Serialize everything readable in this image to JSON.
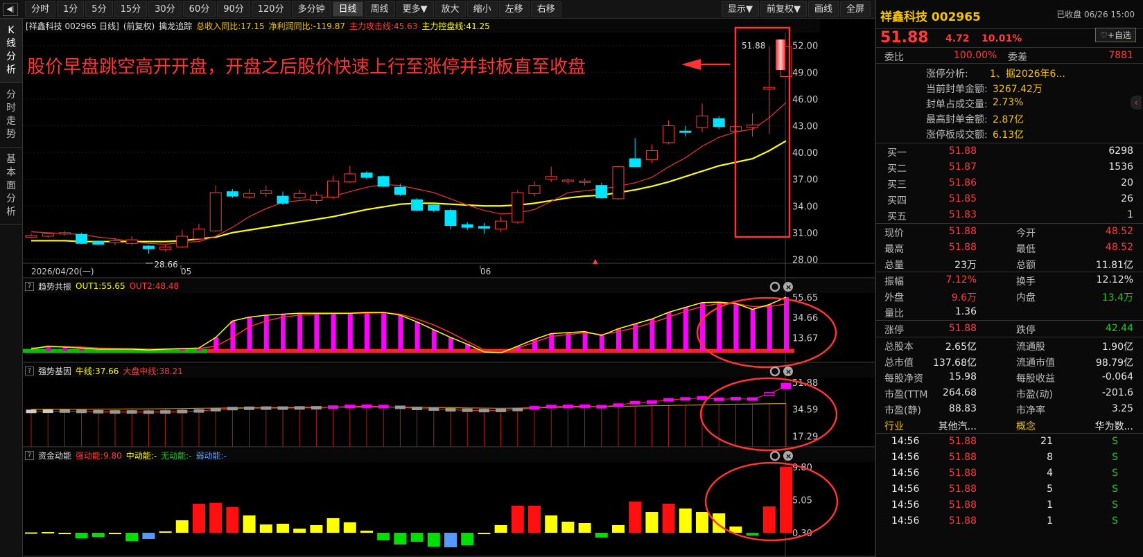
{
  "toolbar": {
    "collapse": "◀|",
    "items": [
      "分时",
      "1分",
      "5分",
      "15分",
      "30分",
      "60分",
      "90分",
      "120分",
      "多分钟",
      "日线",
      "周线",
      "更多▼",
      "放大",
      "缩小",
      "左移",
      "右移"
    ],
    "active": "日线",
    "right": [
      "显示▼",
      "前复权▼",
      "画线",
      "全屏"
    ]
  },
  "side_tabs": [
    "K线分析",
    "分时走势",
    "基本面分析"
  ],
  "main_header": {
    "stock": "[祥鑫科技 002965 日线]",
    "adj": "(前复权)",
    "ind": "擒龙追踪",
    "revenue_yoy": "总收入同比:17.15",
    "profit_yoy": "净利润同比:-119.87",
    "attack": "主力攻击线:45.63",
    "control": "主力控盘线:41.25"
  },
  "annotation": "股价早盘跳空高开开盘，开盘之后股价快速上行至涨停并封板直至收盘",
  "date_axis": {
    "start": "2026/04/20(一)",
    "m1": "05",
    "m2": "06"
  },
  "price_axis": [
    "52.00",
    "49.00",
    "46.00",
    "43.00",
    "40.00",
    "37.00",
    "34.00",
    "31.00",
    "28.00"
  ],
  "low_label": "28.66",
  "high_label": "51.88",
  "panel1": {
    "name": "趋势共振",
    "out1": "OUT1:55.65",
    "out2": "OUT2:48.48",
    "axis": [
      "55.65",
      "34.66",
      "13.67"
    ]
  },
  "panel2": {
    "name": "强势基因",
    "bull": "牛线:37.66",
    "market": "大盘中线:38.21",
    "axis": [
      "51.88",
      "34.59",
      "17.29"
    ]
  },
  "panel3": {
    "name": "资金动能",
    "strong": "强动能:9.80",
    "mid": "中动能:-",
    "none": "无动能:-",
    "weak": "弱动能:-",
    "axis": [
      "9.80",
      "5.05",
      "0.30"
    ]
  },
  "chart_data": [
    {
      "type": "candlestick",
      "title": "祥鑫科技 002965 日线",
      "open": [
        30.5,
        30.6,
        30.9,
        30.8,
        30.0,
        29.9,
        29.8,
        29.5,
        29.1,
        29.4,
        30.3,
        31.2,
        35.6,
        35.0,
        35.4,
        35.1,
        34.9,
        34.6,
        35.0,
        36.7,
        37.7,
        37.3,
        36.1,
        34.7,
        34.1,
        33.5,
        31.9,
        31.7,
        31.4,
        32.2,
        35.4,
        37.0,
        36.8,
        36.8,
        36.3,
        34.8,
        39.3,
        39.2,
        41.1,
        42.4,
        42.8,
        43.8,
        42.4,
        42.8,
        47.1,
        48.52
      ],
      "close": [
        30.7,
        30.9,
        31.0,
        29.8,
        29.7,
        30.1,
        30.2,
        29.2,
        29.4,
        30.6,
        31.4,
        35.5,
        35.1,
        35.4,
        35.7,
        34.3,
        35.4,
        35.2,
        36.8,
        37.6,
        37.2,
        36.2,
        35.3,
        33.5,
        33.5,
        31.8,
        31.6,
        31.5,
        32.3,
        35.5,
        36.3,
        37.3,
        36.9,
        36.8,
        34.9,
        38.4,
        38.4,
        40.2,
        43.0,
        42.3,
        44.1,
        42.9,
        42.9,
        43.1,
        47.3,
        51.88
      ],
      "high": [
        30.9,
        31.0,
        31.2,
        31.0,
        30.1,
        30.4,
        30.6,
        29.6,
        29.6,
        31.3,
        32.0,
        36.3,
        35.9,
        35.9,
        36.3,
        35.6,
        35.8,
        35.6,
        37.4,
        38.5,
        37.9,
        37.4,
        36.5,
        34.9,
        34.3,
        33.7,
        32.2,
        32.1,
        32.8,
        35.8,
        36.8,
        38.4,
        37.1,
        37.1,
        36.6,
        38.5,
        41.6,
        40.9,
        43.6,
        43.0,
        45.5,
        44.1,
        43.5,
        44.4,
        51.88,
        51.88
      ],
      "low": [
        30.4,
        30.4,
        30.7,
        29.7,
        29.6,
        29.6,
        29.6,
        28.66,
        28.9,
        29.3,
        30.1,
        31.1,
        34.9,
        34.8,
        35.0,
        34.1,
        34.8,
        34.3,
        34.8,
        36.6,
        37.0,
        36.1,
        35.1,
        33.4,
        33.3,
        31.4,
        31.3,
        30.9,
        31.1,
        32.0,
        35.1,
        36.7,
        36.4,
        36.3,
        34.8,
        34.7,
        39.0,
        38.8,
        40.9,
        41.8,
        42.3,
        42.6,
        41.7,
        41.8,
        42.1,
        48.52
      ],
      "ma_fast": [
        31.1,
        31.0,
        30.9,
        30.8,
        30.5,
        30.3,
        30.0,
        29.8,
        29.7,
        29.9,
        30.0,
        30.6,
        31.6,
        32.8,
        33.7,
        34.4,
        34.6,
        34.8,
        35.1,
        35.6,
        36.1,
        36.4,
        36.3,
        35.9,
        35.5,
        34.8,
        34.1,
        33.5,
        33.1,
        33.2,
        33.6,
        34.5,
        35.5,
        35.7,
        35.9,
        36.2,
        36.6,
        37.2,
        38.4,
        39.4,
        40.7,
        41.7,
        42.3,
        42.6,
        43.9,
        45.6
      ],
      "ma_slow": [
        30.1,
        30.1,
        30.1,
        30.0,
        30.0,
        30.0,
        30.0,
        30.0,
        30.0,
        30.1,
        30.3,
        30.5,
        31.0,
        31.3,
        31.6,
        31.9,
        32.2,
        32.5,
        32.8,
        33.2,
        33.6,
        33.9,
        34.2,
        34.3,
        34.3,
        34.2,
        34.1,
        34.0,
        34.0,
        34.1,
        34.3,
        34.6,
        34.9,
        35.1,
        35.2,
        35.5,
        35.8,
        36.2,
        36.7,
        37.3,
        37.9,
        38.5,
        38.9,
        39.3,
        40.2,
        41.3
      ],
      "x_labels": [
        "2026/04/20(一)",
        "05",
        "06"
      ],
      "y_ticks": [
        "52.00",
        "49.00",
        "46.00",
        "43.00",
        "40.00",
        "37.00",
        "34.00",
        "31.00",
        "28.00"
      ]
    },
    {
      "type": "bar",
      "title": "趋势共振",
      "series": [
        {
          "name": "OUT1",
          "values": [
            2.0,
            5.0,
            4.0,
            3.0,
            2.0,
            2.0,
            2.0,
            1.0,
            2.0,
            2.5,
            3.0,
            14.0,
            31.0,
            35.0,
            37.0,
            38.0,
            39.0,
            39.0,
            39.0,
            39.0,
            40.0,
            40.0,
            37.0,
            30.0,
            22.0,
            14.0,
            7.0,
            -1.0,
            -2.0,
            5.0,
            12.0,
            18.0,
            19.0,
            20.0,
            16.0,
            23.0,
            28.0,
            33.0,
            40.0,
            45.0,
            50.0,
            50.5,
            49.0,
            43.0,
            48.0,
            55.65
          ]
        },
        {
          "name": "OUT2",
          "values": [
            3.0,
            4.0,
            4.5,
            4.0,
            3.0,
            2.5,
            2.2,
            2.0,
            2.0,
            2.2,
            2.5,
            5.0,
            14.0,
            25.0,
            31.0,
            35.0,
            37.0,
            38.0,
            38.5,
            38.8,
            39.0,
            39.5,
            38.0,
            33.0,
            27.0,
            19.0,
            10.0,
            1.0,
            -2.0,
            3.0,
            9.0,
            15.0,
            17.0,
            19.0,
            17.0,
            20.0,
            24.0,
            29.0,
            35.0,
            41.0,
            46.0,
            49.0,
            49.0,
            46.0,
            46.0,
            48.48
          ]
        }
      ],
      "y_ticks": [
        "55.65",
        "34.66",
        "13.67"
      ]
    },
    {
      "type": "bar",
      "title": "强势基因",
      "series": [
        {
          "name": "牛线",
          "values": [
            33.2,
            33.3,
            33.4,
            33.2,
            33.0,
            32.8,
            32.8,
            32.7,
            32.8,
            33.1,
            33.5,
            34.3,
            35.0,
            35.2,
            35.3,
            35.3,
            35.4,
            35.5,
            35.9,
            36.4,
            36.5,
            36.3,
            35.8,
            35.1,
            34.7,
            34.2,
            33.9,
            33.7,
            33.8,
            34.4,
            35.5,
            36.3,
            36.4,
            36.5,
            36.2,
            37.2,
            38.8,
            39.2,
            40.6,
            41.2,
            41.8,
            41.0,
            41.3,
            41.1,
            44.4,
            49.5
          ]
        },
        {
          "name": "大盘中线",
          "values": [
            34.5,
            34.6,
            34.6,
            34.6,
            34.7,
            34.7,
            34.8,
            34.8,
            34.9,
            35.0,
            35.2,
            35.3,
            35.4,
            35.5,
            35.6,
            35.7,
            35.8,
            35.8,
            35.9,
            36.0,
            36.0,
            36.0,
            35.9,
            35.8,
            35.7,
            35.6,
            35.4,
            35.3,
            35.2,
            35.3,
            35.5,
            35.7,
            35.9,
            36.1,
            36.2,
            36.4,
            36.6,
            36.8,
            37.0,
            37.2,
            37.4,
            37.6,
            37.8,
            37.9,
            38.1,
            38.21
          ]
        }
      ],
      "y_ticks": [
        "51.88",
        "34.59",
        "17.29"
      ]
    },
    {
      "type": "bar",
      "title": "资金动能",
      "values": [
        0.35,
        0.4,
        0.1,
        -0.5,
        -0.3,
        0.2,
        -0.9,
        -0.6,
        0.5,
        2.1,
        4.5,
        4.6,
        4.0,
        2.8,
        1.5,
        1.6,
        0.9,
        1.4,
        2.4,
        1.8,
        0.6,
        -0.8,
        -1.4,
        -1.0,
        -1.7,
        -1.8,
        -1.5,
        0.1,
        1.4,
        4.2,
        4.2,
        2.8,
        1.9,
        1.7,
        -0.4,
        1.4,
        4.8,
        3.3,
        4.5,
        3.8,
        3.3,
        3.1,
        1.2,
        -0.1,
        4.1,
        9.8
      ],
      "y_ticks": [
        "9.80",
        "5.05",
        "0.30"
      ]
    }
  ],
  "right_panel": {
    "name": "祥鑫科技 002965",
    "status": "已收盘 06/26 15:00",
    "fav": "♡+自选",
    "price": "51.88",
    "change": "4.72",
    "pct": "10.01%",
    "weibi": {
      "l": "委比",
      "v": "100.00%",
      "l2": "委差",
      "v2": "7881"
    },
    "limit": [
      {
        "l": "涨停分析:",
        "v": "1、据2026年6..."
      },
      {
        "l": "当前封单金额:",
        "v": "3267.42万"
      },
      {
        "l": "封单占成交量:",
        "v": "2.73%"
      },
      {
        "l": "最高封单金额:",
        "v": "2.87亿"
      },
      {
        "l": "涨停板成交额:",
        "v": "6.13亿"
      }
    ],
    "book": [
      {
        "l": "买一",
        "p": "51.88",
        "q": "6298"
      },
      {
        "l": "买二",
        "p": "51.87",
        "q": "1536"
      },
      {
        "l": "买三",
        "p": "51.86",
        "q": "20"
      },
      {
        "l": "买四",
        "p": "51.85",
        "q": "26"
      },
      {
        "l": "买五",
        "p": "51.83",
        "q": "1"
      }
    ],
    "stats1": [
      {
        "l": "现价",
        "v": "51.88",
        "l2": "今开",
        "v2": "48.52"
      },
      {
        "l": "最高",
        "v": "51.88",
        "l2": "最低",
        "v2": "48.52"
      },
      {
        "l": "总量",
        "v": "23万",
        "l2": "总额",
        "v2": "11.81亿"
      }
    ],
    "stats2": [
      {
        "l": "振幅",
        "v": "7.12%",
        "l2": "换手",
        "v2": "12.12%"
      },
      {
        "l": "外盘",
        "v": "9.6万",
        "l2": "内盘",
        "v2": "13.4万"
      },
      {
        "l": "量比",
        "v": "1.36",
        "l2": "",
        "v2": ""
      }
    ],
    "stats3": [
      {
        "l": "涨停",
        "v": "51.88",
        "l2": "跌停",
        "v2": "42.44"
      }
    ],
    "stats4": [
      {
        "l": "总股本",
        "v": "2.65亿",
        "l2": "流通股",
        "v2": "1.90亿"
      },
      {
        "l": "总市值",
        "v": "137.68亿",
        "l2": "流通市值",
        "v2": "98.79亿"
      },
      {
        "l": "每股净资",
        "v": "15.98",
        "l2": "每股收益",
        "v2": "-0.064"
      },
      {
        "l": "市盈(TTM",
        "v": "264.68",
        "l2": "市盈(动)",
        "v2": "-201.6"
      },
      {
        "l": "市盈(静)",
        "v": "88.83",
        "l2": "市净率",
        "v2": "3.25"
      },
      {
        "l": "行业",
        "v": "其他汽...",
        "l2": "概念",
        "v2": "华为数..."
      }
    ],
    "ticks": [
      {
        "t": "14:56",
        "p": "51.88",
        "q": "21",
        "s": "S"
      },
      {
        "t": "14:56",
        "p": "51.88",
        "q": "8",
        "s": "S"
      },
      {
        "t": "14:56",
        "p": "51.88",
        "q": "4",
        "s": "S"
      },
      {
        "t": "14:56",
        "p": "51.88",
        "q": "5",
        "s": "S"
      },
      {
        "t": "14:56",
        "p": "51.88",
        "q": "1",
        "s": "S"
      },
      {
        "t": "14:56",
        "p": "51.88",
        "q": "1",
        "s": "S"
      }
    ]
  },
  "colors": {
    "up": "#ff3b3b",
    "down": "#00e5ff",
    "ma_fast": "#e03030",
    "ma_slow": "#ffff00",
    "magenta": "#ff00ff",
    "annotation": "#ff3333"
  }
}
